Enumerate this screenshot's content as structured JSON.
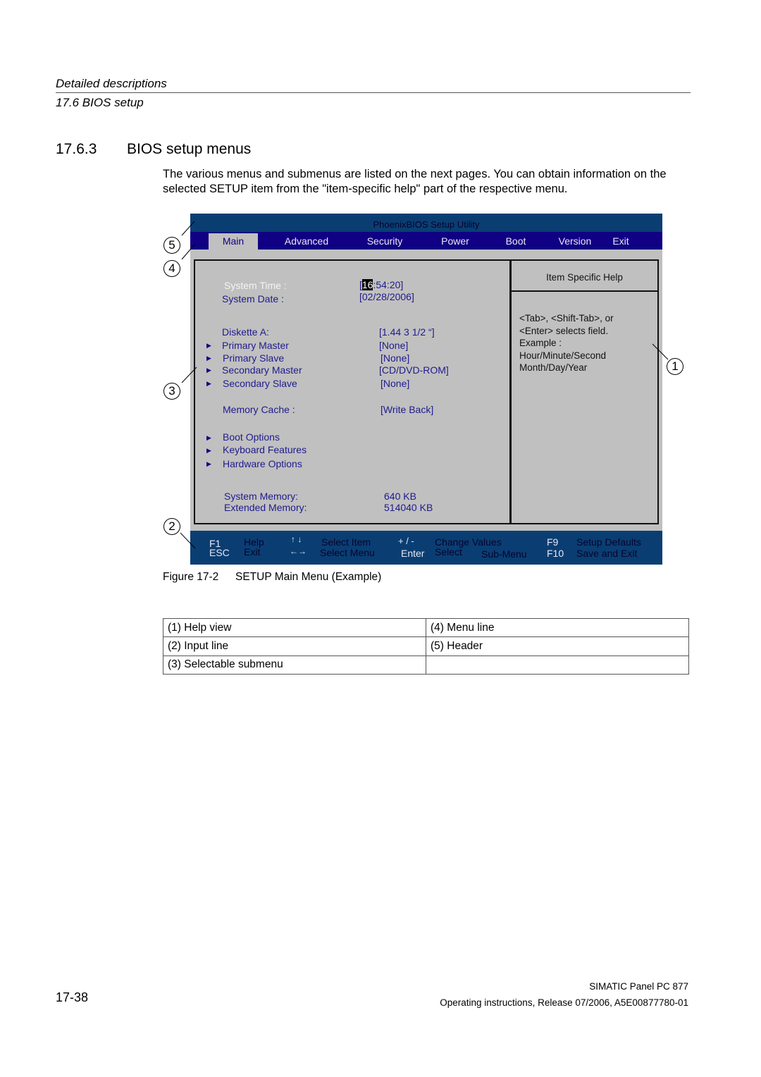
{
  "running_head": {
    "chapter": "Detailed descriptions",
    "section": "17.6 BIOS setup"
  },
  "section": {
    "number": "17.6.3",
    "title": "BIOS setup menus",
    "intro": "The various menus and submenus are listed on the next pages. You can obtain information on the selected SETUP item from the \"item-specific help\" part of the respective menu."
  },
  "bios": {
    "header_title": "PhoenixBIOS Setup Utility",
    "menu_tabs": [
      {
        "label": "Main",
        "active": true
      },
      {
        "label": "Advanced",
        "active": false
      },
      {
        "label": "Security",
        "active": false
      },
      {
        "label": "Power",
        "active": false
      },
      {
        "label": "Boot",
        "active": false
      },
      {
        "label": "Version",
        "active": false
      },
      {
        "label": "Exit",
        "active": false
      }
    ],
    "system_time": {
      "label": "System Time :",
      "value_open": "[",
      "value_highlight": "16",
      "value_rest": ":54:20]"
    },
    "system_date": {
      "label": "System Date :",
      "value": "[02/28/2006]"
    },
    "items": [
      {
        "label": "Diskette A:",
        "value": "[1.44  3 1/2 “]",
        "submenu": false
      },
      {
        "label": "Primary Master",
        "value": "[None]",
        "submenu": true
      },
      {
        "label": "Primary Slave",
        "value": "[None]",
        "submenu": true
      },
      {
        "label": "Secondary Master",
        "value": "[CD/DVD-ROM]",
        "submenu": true
      },
      {
        "label": "Secondary Slave",
        "value": "[None]",
        "submenu": true
      }
    ],
    "memory_cache": {
      "label": "Memory Cache :",
      "value": "[Write Back]"
    },
    "submenus": [
      {
        "label": "Boot Options"
      },
      {
        "label": "Keyboard Features"
      },
      {
        "label": "Hardware Options"
      }
    ],
    "system_memory": {
      "label": "System Memory:",
      "value": "640 KB"
    },
    "extended_memory": {
      "label": "Extended Memory:",
      "value": "514040 KB"
    },
    "help": {
      "title": "Item Specific Help",
      "lines": [
        "<Tab>,  <Shift-Tab>, or",
        "<Enter> selects field.",
        "Example :",
        "Hour/Minute/Second",
        "Month/Day/Year"
      ]
    },
    "footer": {
      "f1_key": "F1",
      "f1_action": "Help",
      "esc_key": "ESC",
      "esc_action": "Exit",
      "updown_icon": "↑ ↓",
      "updown_action": "Select Item",
      "leftright_icon": "←→",
      "leftright_action": "Select Menu",
      "plusminus_key": "+ / -",
      "plusminus_action": "Change Values",
      "enter_key": "Enter",
      "enter_action": "Select",
      "enter_action2": "Sub-Menu",
      "f9_key": "F9",
      "f9_action": "Setup Defaults",
      "f10_key": "F10",
      "f10_action": "Save and Exit"
    }
  },
  "callouts": [
    "1",
    "2",
    "3",
    "4",
    "5"
  ],
  "figure": {
    "number": "Figure 17-2",
    "caption": "SETUP Main Menu (Example)"
  },
  "legend": [
    [
      "(1) Help view",
      "(4) Menu line"
    ],
    [
      "(2) Input line",
      "(5) Header"
    ],
    [
      "(3) Selectable submenu",
      ""
    ]
  ],
  "page_footer": {
    "page_number": "17-38",
    "product": "SIMATIC Panel PC 877",
    "doc_info": "Operating instructions, Release 07/2006, A5E00877780-01"
  }
}
